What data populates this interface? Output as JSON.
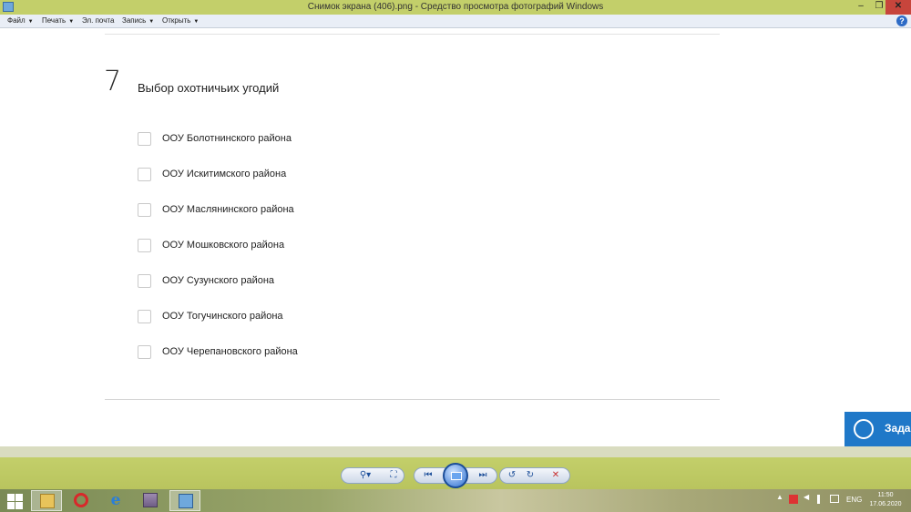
{
  "window": {
    "title": "Снимок экрана (406).png - Средство просмотра фотографий Windows",
    "minimize": "–",
    "maximize": "❐",
    "close": "✕"
  },
  "menu": {
    "items": [
      {
        "label": "Файл"
      },
      {
        "label": "Печать"
      },
      {
        "label": "Эл. почта"
      },
      {
        "label": "Запись"
      },
      {
        "label": "Открыть"
      }
    ],
    "dropdown_glyph": "▼",
    "help": "?"
  },
  "question": {
    "number": "7",
    "title": "Выбор охотничьих угодий",
    "options": [
      {
        "label": "ООУ Болотнинского района",
        "checked": false
      },
      {
        "label": "ООУ Искитимского района",
        "checked": false
      },
      {
        "label": "ООУ Маслянинского района",
        "checked": false
      },
      {
        "label": "ООУ Мошковского района",
        "checked": false
      },
      {
        "label": "ООУ Сузунского района",
        "checked": false
      },
      {
        "label": "ООУ Тогучинского района",
        "checked": false
      },
      {
        "label": "ООУ Черепановского района",
        "checked": false
      }
    ]
  },
  "help_widget": {
    "label": "Зада",
    "icon": "support-agent-icon",
    "color": "#1f78c8"
  },
  "viewer_toolbar": {
    "zoom": "⚲▾",
    "fit": "⛶",
    "prev": "⏮",
    "next": "⏭",
    "rotate_ccw": "↺",
    "rotate_cw": "↻",
    "delete": "✕"
  },
  "taskbar": {
    "apps": [
      {
        "icon": "file-explorer-icon"
      },
      {
        "icon": "opera-icon"
      },
      {
        "icon": "internet-explorer-icon"
      },
      {
        "icon": "archive-icon"
      },
      {
        "icon": "photo-viewer-icon",
        "active": true
      }
    ],
    "tray": {
      "chevron": "▲",
      "language": "ENG"
    },
    "clock": {
      "time": "11:50",
      "date": "17.06.2020"
    }
  }
}
